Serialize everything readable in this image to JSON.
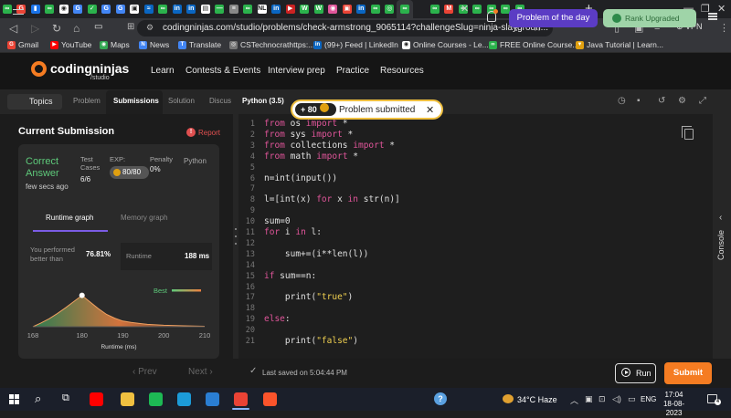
{
  "browser": {
    "tab_favicons": [
      {
        "color": "#2bb24c",
        "glyph": "∞"
      },
      {
        "color": "#ea4335",
        "glyph": "G"
      },
      {
        "color": "#1a73e8",
        "glyph": "▮"
      },
      {
        "color": "#2bb24c",
        "glyph": "∞"
      },
      {
        "color": "#ffffff",
        "glyph": "◉"
      },
      {
        "color": "#4285f4",
        "glyph": "G"
      },
      {
        "color": "#2bb24c",
        "glyph": "✓"
      },
      {
        "color": "#4285f4",
        "glyph": "G"
      },
      {
        "color": "#4285f4",
        "glyph": "G"
      },
      {
        "color": "#ffffff",
        "glyph": "▣"
      },
      {
        "color": "#0a66c2",
        "glyph": "≈"
      },
      {
        "color": "#2bb24c",
        "glyph": "∞"
      },
      {
        "color": "#0a66c2",
        "glyph": "in"
      },
      {
        "color": "#0a66c2",
        "glyph": "in"
      },
      {
        "color": "#ffffff",
        "glyph": "▤"
      },
      {
        "color": "#2bb24c",
        "glyph": "—"
      },
      {
        "color": "#888888",
        "glyph": "≡"
      },
      {
        "color": "#2bb24c",
        "glyph": "∞"
      },
      {
        "color": "#ffffff",
        "glyph": "NL"
      },
      {
        "color": "#0a66c2",
        "glyph": "in"
      },
      {
        "color": "#cc2222",
        "glyph": "▶"
      },
      {
        "color": "#2bb24c",
        "glyph": "W"
      },
      {
        "color": "#2bb24c",
        "glyph": "W"
      },
      {
        "color": "#e0559a",
        "glyph": "◉"
      },
      {
        "color": "#ea4335",
        "glyph": "▣"
      },
      {
        "color": "#0a66c2",
        "glyph": "in"
      },
      {
        "color": "#2bb24c",
        "glyph": "∞"
      },
      {
        "color": "#2bb24c",
        "glyph": "◎"
      },
      {
        "color": "#2bb24c",
        "glyph": "∞"
      }
    ],
    "tab_close": "✕",
    "tabs_after": [
      {
        "color": "#2bb24c",
        "glyph": "∞"
      },
      {
        "color": "#ea4335",
        "glyph": "M"
      },
      {
        "color": "#2bb24c",
        "glyph": "∞"
      },
      {
        "color": "#2bb24c",
        "glyph": "∞"
      },
      {
        "color": "#2bb24c",
        "glyph": "∞"
      },
      {
        "color": "#2bb24c",
        "glyph": "∞"
      },
      {
        "color": "#2bb24c",
        "glyph": "∞"
      }
    ],
    "new_tab": "+",
    "url": "codingninjas.com/studio/problems/check-armstrong_9065114?challengeSlug=ninja-slaygroun...",
    "vpn_label": "VPN"
  },
  "bookmarks": [
    {
      "label": "Gmail",
      "icon": "gmail-icon",
      "color": "#ea4335",
      "glyph": "G"
    },
    {
      "label": "YouTube",
      "icon": "youtube-icon",
      "color": "#ff0000",
      "glyph": "▶"
    },
    {
      "label": "Maps",
      "icon": "maps-icon",
      "color": "#34a853",
      "glyph": "◉"
    },
    {
      "label": "News",
      "icon": "news-icon",
      "color": "#4285f4",
      "glyph": "N"
    },
    {
      "label": "Translate",
      "icon": "translate-icon",
      "color": "#4285f4",
      "glyph": "T"
    },
    {
      "label": "CSTechnocrathttps:...",
      "icon": "globe-icon",
      "color": "#777777",
      "glyph": "◎"
    },
    {
      "label": "(99+) Feed | LinkedIn",
      "icon": "linkedin-icon",
      "color": "#0a66c2",
      "glyph": "in"
    },
    {
      "label": "Online Courses - Le...",
      "icon": "courses-icon",
      "color": "#ffffff",
      "glyph": "◉"
    },
    {
      "label": "FREE Online Course...",
      "icon": "infinity-icon",
      "color": "#2bb24c",
      "glyph": "∞"
    },
    {
      "label": "Java Tutorial | Learn...",
      "icon": "java-icon",
      "color": "#e0a010",
      "glyph": "▼"
    }
  ],
  "site": {
    "logo_text": "codingninjas",
    "logo_sub": "/studio",
    "nav": [
      "Learn",
      "Contests & Events",
      "Interview prep",
      "Practice",
      "Resources"
    ],
    "potd_label": "Problem of the day",
    "rank_label": "Rank Upgraded"
  },
  "toolbar": {
    "topics_label": "Topics",
    "tabs": [
      "Problem",
      "Submissions",
      "Solution",
      "Discus"
    ],
    "language": "Python (3.5)"
  },
  "toast": {
    "points": "+ 80",
    "message": "Problem submitted"
  },
  "submission": {
    "title": "Current Submission",
    "report_label": "Report",
    "verdict": "Correct Answer",
    "verdict_time": "few secs ago",
    "test_cases_label": "Test Cases",
    "test_cases_value": "6/6",
    "exp_label": "EXP:",
    "exp_value": "80/80",
    "penalty_label": "Penalty",
    "penalty_value": "0%",
    "language": "Python",
    "graph_tabs": [
      "Runtime graph",
      "Memory graph"
    ],
    "performed_label": "You performed better than",
    "performed_value": "76.81%",
    "runtime_label": "Runtime",
    "runtime_value": "188 ms",
    "prev_label": "Prev",
    "next_label": "Next"
  },
  "chart_data": {
    "type": "area",
    "x": [
      168,
      170,
      172,
      174,
      176,
      178,
      180,
      182,
      184,
      186,
      188,
      190,
      192,
      194,
      196,
      198,
      200,
      205,
      210
    ],
    "values": [
      0,
      8,
      17,
      28,
      40,
      53,
      66,
      52,
      38,
      26,
      18,
      12,
      9,
      7,
      5,
      4,
      3,
      2,
      1
    ],
    "marker_x": 180,
    "x_ticks": [
      "168",
      "180",
      "190",
      "200",
      "210"
    ],
    "xlabel": "Runtime (ms)",
    "legend": "Best",
    "xlim": [
      168,
      210
    ],
    "ylim": [
      0,
      100
    ],
    "colors": {
      "gradient_start": "#2e8b57",
      "gradient_end": "#f08040",
      "legend": "#5ec97a"
    }
  },
  "editor": {
    "lines": [
      {
        "n": "1",
        "code": "from os import *"
      },
      {
        "n": "2",
        "code": "from sys import *"
      },
      {
        "n": "3",
        "code": "from collections import *"
      },
      {
        "n": "4",
        "code": "from math import *"
      },
      {
        "n": "5",
        "code": ""
      },
      {
        "n": "6",
        "code": "n=int(input())"
      },
      {
        "n": "7",
        "code": ""
      },
      {
        "n": "8",
        "code": "l=[int(x) for x in str(n)]"
      },
      {
        "n": "9",
        "code": ""
      },
      {
        "n": "10",
        "code": "sum=0"
      },
      {
        "n": "11",
        "code": "for i in l:"
      },
      {
        "n": "12",
        "code": ""
      },
      {
        "n": "13",
        "code": "    sum+=(i**len(l))"
      },
      {
        "n": "14",
        "code": ""
      },
      {
        "n": "15",
        "code": "if sum==n:"
      },
      {
        "n": "16",
        "code": ""
      },
      {
        "n": "17",
        "code": "    print(\"true\")"
      },
      {
        "n": "18",
        "code": ""
      },
      {
        "n": "19",
        "code": "else:"
      },
      {
        "n": "20",
        "code": ""
      },
      {
        "n": "21",
        "code": "    print(\"false\")"
      }
    ],
    "saved_text": "Last saved on 5:04:44 PM",
    "run_label": "Run",
    "submit_label": "Submit",
    "console_label": "Console"
  },
  "taskbar": {
    "apps": [
      {
        "name": "youtube-app-icon",
        "color": "#ff0000"
      },
      {
        "name": "file-explorer-icon",
        "color": "#f0c040"
      },
      {
        "name": "spotify-icon",
        "color": "#1db954"
      },
      {
        "name": "edge-icon",
        "color": "#1c9bd8"
      },
      {
        "name": "vscode-icon",
        "color": "#2a7ed3"
      },
      {
        "name": "chrome-icon",
        "color": "#ea4335"
      },
      {
        "name": "brave-icon",
        "color": "#fb542b"
      }
    ],
    "weather": "34°C  Haze",
    "lang": "ENG",
    "time": "17:04",
    "date": "18-08-2023",
    "notif_count": "4"
  }
}
